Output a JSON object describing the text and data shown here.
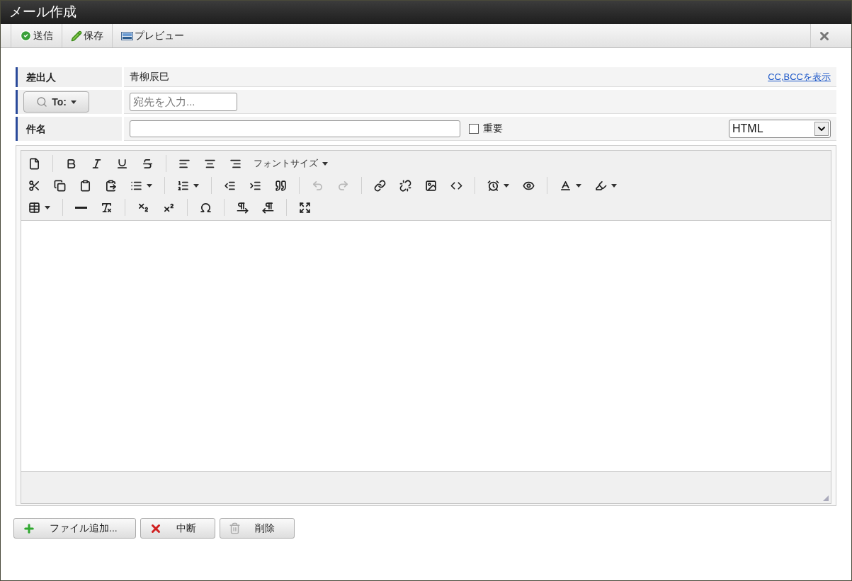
{
  "window": {
    "title": "メール作成"
  },
  "toolbar": {
    "buttons": [
      {
        "kind": "send",
        "label": "送信"
      },
      {
        "kind": "save",
        "label": "保存"
      },
      {
        "kind": "preview",
        "label": "プレビュー"
      }
    ]
  },
  "form": {
    "sender": {
      "label": "差出人",
      "value": "青柳辰巳",
      "link": "CC,BCCを表示"
    },
    "to": {
      "button": "To:",
      "placeholder": "宛先を入力..."
    },
    "subject": {
      "label": "件名",
      "important": {
        "label": "重要",
        "checked": false
      },
      "format": "HTML"
    }
  },
  "editor": {
    "font_size_label": "フォントサイズ",
    "undo_disabled": true,
    "redo_disabled": true
  },
  "actions": [
    {
      "kind": "add",
      "label": "ファイル追加..."
    },
    {
      "kind": "cancel",
      "label": "中断"
    },
    {
      "kind": "delete",
      "label": "削除"
    }
  ]
}
